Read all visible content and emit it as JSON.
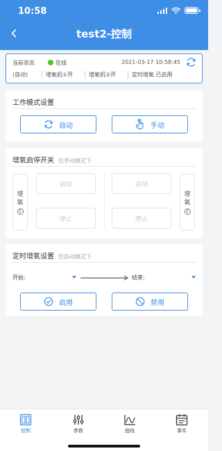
{
  "status_bar": {
    "time": "10:58"
  },
  "nav": {
    "title": "test2-控制"
  },
  "status": {
    "label": "当前状态",
    "online_text": "在线",
    "datetime": "2021-03-17 10:58:45",
    "mode": "(自动)",
    "aerator1": "增氧机①开",
    "aerator2": "增氧机②开",
    "timer": "定时增氧 已启用"
  },
  "work_mode": {
    "title": "工作模式设置",
    "auto_label": "自动",
    "manual_label": "手动"
  },
  "aerator_switch": {
    "title": "增氧启停开关",
    "subtitle": "仅手动模式下",
    "left_char1": "增",
    "left_char2": "氧",
    "left_num": "1",
    "right_char1": "增",
    "right_char2": "氧",
    "right_num": "2",
    "start_label": "启动",
    "stop_label": "停止"
  },
  "timed_aeration": {
    "title": "定时增氧设置",
    "subtitle": "仅自动模式下",
    "start_label": "开始:",
    "end_label": "结束:",
    "enable_label": "启用",
    "disable_label": "禁用"
  },
  "tabs": [
    {
      "label": "控制",
      "icon": "control-panel-icon",
      "active": true
    },
    {
      "label": "参数",
      "icon": "sliders-icon",
      "active": false
    },
    {
      "label": "曲线",
      "icon": "chart-curve-icon",
      "active": false
    },
    {
      "label": "事件",
      "icon": "calendar-icon",
      "active": false
    }
  ],
  "colors": {
    "primary": "#3f8ee6",
    "online": "#52c41a",
    "background": "#f3f4f6"
  }
}
